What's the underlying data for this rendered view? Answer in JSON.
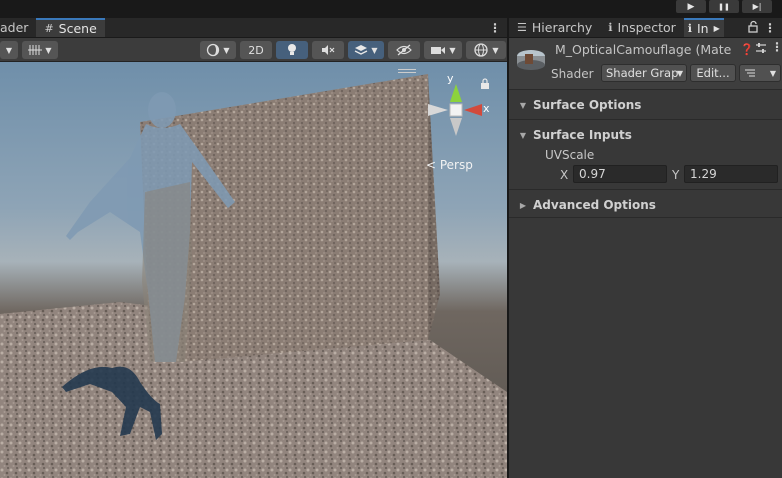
{
  "playbar": {
    "play": "▶",
    "pause": "❚❚",
    "step": "▶|"
  },
  "left_tabs": [
    {
      "label": "ader",
      "icon": ""
    },
    {
      "label": "Scene",
      "icon": "#"
    }
  ],
  "right_tabs": [
    {
      "label": "Hierarchy",
      "icon": "☰"
    },
    {
      "label": "Inspector",
      "icon": "ℹ"
    },
    {
      "label": "In",
      "icon": "ℹ"
    }
  ],
  "menu_glyph": "⋮",
  "lock_glyph": "🔓",
  "scene_toolbar": {
    "mode_2d": "2D",
    "persp_label": "< Persp",
    "gizmo_y": "y",
    "gizmo_x": "x"
  },
  "inspector": {
    "material_name": "M_OpticalCamouflage (Mate",
    "shader_label": "Shader",
    "shader_value": "Shader Grap",
    "edit_button": "Edit...",
    "sections": [
      {
        "title": "Surface Options",
        "expanded": false
      },
      {
        "title": "Surface Inputs",
        "expanded": true
      },
      {
        "title": "Advanced Options",
        "expanded": false
      }
    ],
    "uvscale": {
      "label": "UVScale",
      "x_label": "X",
      "x_value": "0.97",
      "y_label": "Y",
      "y_value": "1.29"
    }
  },
  "colors": {
    "accent": "#3a79bb",
    "gizmo_y": "#8cd23c",
    "gizmo_x": "#d24a3c"
  }
}
